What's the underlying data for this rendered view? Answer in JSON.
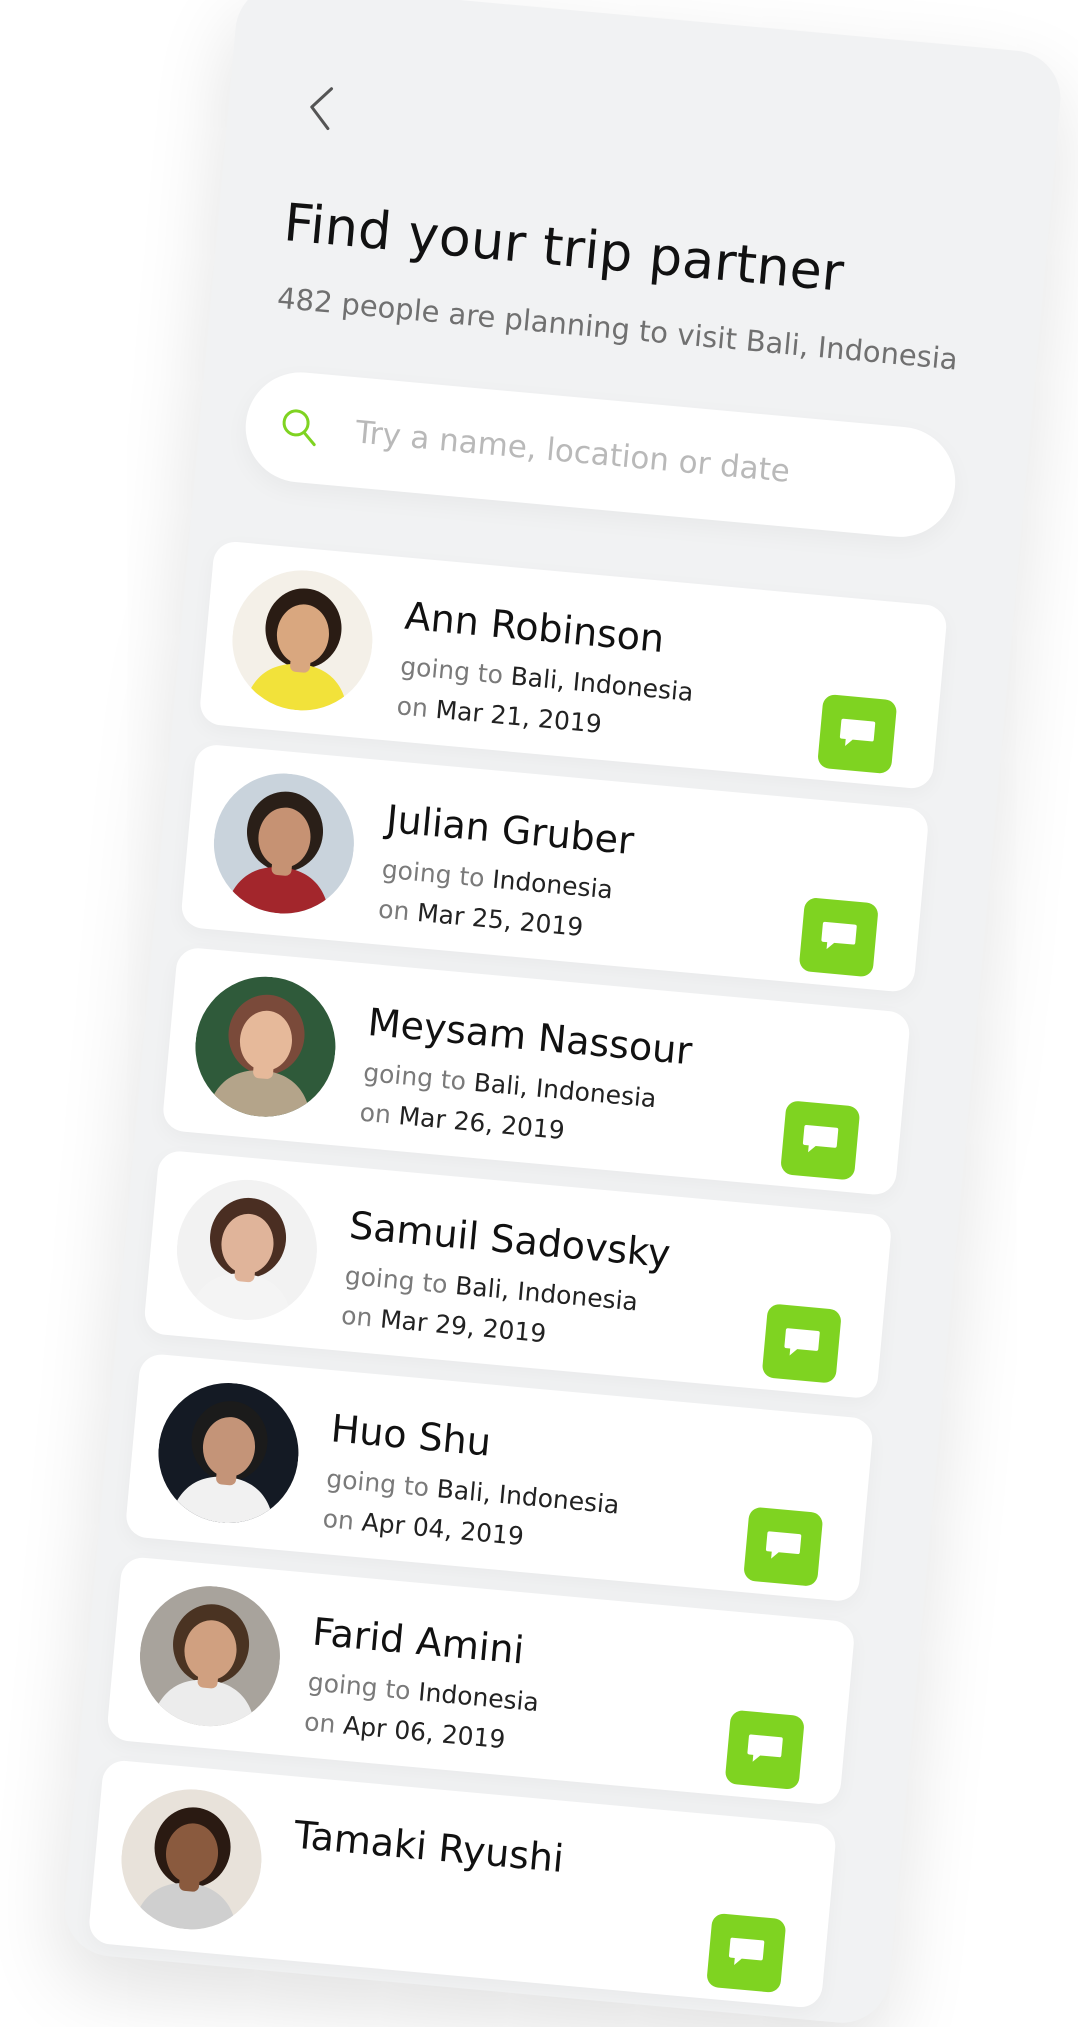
{
  "header": {
    "title": "Find your trip partner",
    "subtitle": "482 people are planning to visit Bali, Indonesia"
  },
  "search": {
    "placeholder": "Try a name, location or date",
    "value": ""
  },
  "colors": {
    "accent": "#7fd321",
    "background": "#f1f2f3",
    "card": "#ffffff"
  },
  "labels": {
    "going_to": "going to",
    "on": "on"
  },
  "people": [
    {
      "name": "Ann Robinson",
      "destination": "Bali, Indonesia",
      "date": "Mar 21, 2019",
      "avatar": {
        "bg": "#f4f0e8",
        "skin": "#d9a77f",
        "hair": "#2a1c14",
        "shirt": "#f2e23a"
      }
    },
    {
      "name": "Julian Gruber",
      "destination": "Indonesia",
      "date": "Mar 25, 2019",
      "avatar": {
        "bg": "#c9d3dc",
        "skin": "#c69273",
        "hair": "#2a1f18",
        "shirt": "#a3262c"
      }
    },
    {
      "name": "Meysam Nassour",
      "destination": "Bali, Indonesia",
      "date": "Mar 26, 2019",
      "avatar": {
        "bg": "#2f5a3a",
        "skin": "#e6b99a",
        "hair": "#7a4a3a",
        "shirt": "#b4a48a"
      }
    },
    {
      "name": "Samuil Sadovsky",
      "destination": "Bali, Indonesia",
      "date": "Mar 29, 2019",
      "avatar": {
        "bg": "#f2f2f2",
        "skin": "#e0b49a",
        "hair": "#4a2e22",
        "shirt": "#f4f4f4"
      }
    },
    {
      "name": "Huo Shu",
      "destination": "Bali, Indonesia",
      "date": "Apr 04, 2019",
      "avatar": {
        "bg": "#141a24",
        "skin": "#c49478",
        "hair": "#1b1b1b",
        "shirt": "#f1f1f1"
      }
    },
    {
      "name": "Farid Amini",
      "destination": "Indonesia",
      "date": "Apr 06, 2019",
      "avatar": {
        "bg": "#a8a39c",
        "skin": "#d0a080",
        "hair": "#4a3322",
        "shirt": "#ececec"
      }
    },
    {
      "name": "Tamaki Ryushi",
      "destination": "",
      "date": "",
      "avatar": {
        "bg": "#e8e2da",
        "skin": "#8a5a3e",
        "hair": "#2a1a12",
        "shirt": "#cfcfcf"
      }
    }
  ]
}
